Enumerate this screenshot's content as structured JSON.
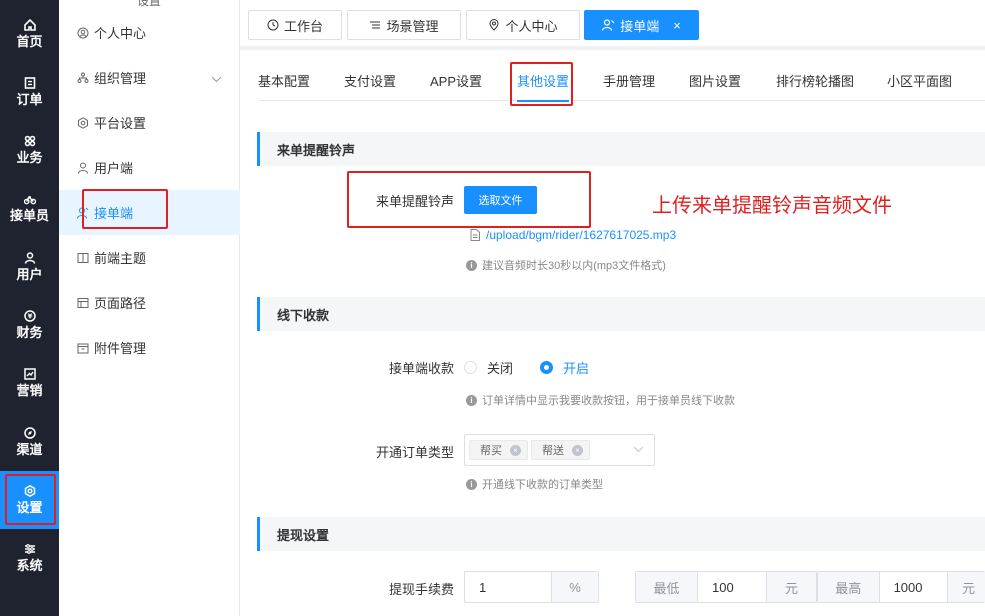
{
  "nav": {
    "items": [
      {
        "label": "首页",
        "icon": "home-icon"
      },
      {
        "label": "订单",
        "icon": "order-icon"
      },
      {
        "label": "业务",
        "icon": "business-icon"
      },
      {
        "label": "接单员",
        "icon": "rider-icon"
      },
      {
        "label": "用户",
        "icon": "user-icon"
      },
      {
        "label": "财务",
        "icon": "finance-icon"
      },
      {
        "label": "营销",
        "icon": "marketing-icon"
      },
      {
        "label": "渠道",
        "icon": "channel-icon"
      },
      {
        "label": "设置",
        "icon": "settings-icon"
      },
      {
        "label": "系统",
        "icon": "system-icon"
      }
    ],
    "active_index": 8,
    "accent": "#1890ff",
    "bg": "#1f2330"
  },
  "submenu": {
    "head": "设置",
    "items": [
      {
        "label": "个人中心",
        "icon": "user-circle-icon"
      },
      {
        "label": "组织管理",
        "icon": "org-icon"
      },
      {
        "label": "平台设置",
        "icon": "hexagon-settings-icon"
      },
      {
        "label": "用户端",
        "icon": "person-icon"
      },
      {
        "label": "接单端",
        "icon": "rider-person-icon"
      },
      {
        "label": "前端主题",
        "icon": "theme-icon"
      },
      {
        "label": "页面路径",
        "icon": "path-icon"
      },
      {
        "label": "附件管理",
        "icon": "attachment-icon"
      }
    ],
    "active_index": 4
  },
  "tags": [
    {
      "label": "工作台",
      "icon": "dashboard-icon"
    },
    {
      "label": "场景管理",
      "icon": "list-icon"
    },
    {
      "label": "个人中心",
      "icon": "location-user-icon"
    },
    {
      "label": "接单端",
      "icon": "rider-person-icon",
      "closable": "×"
    }
  ],
  "tabs": [
    "基本配置",
    "支付设置",
    "APP设置",
    "其他设置",
    "手册管理",
    "图片设置",
    "排行榜轮播图",
    "小区平面图"
  ],
  "active_tab": 3,
  "ringtone": {
    "section_title": "来单提醒铃声",
    "label": "来单提醒铃声",
    "button": "选取文件",
    "file": "/upload/bgm/rider/1627617025.mp3",
    "hint": "建议音频时长30秒以内(mp3文件格式)",
    "annotation": "上传来单提醒铃声音频文件"
  },
  "offline": {
    "section_title": "线下收款",
    "collect_label": "接单端收款",
    "option_off": "关闭",
    "option_on": "开启",
    "collect_hint": "订单详情中显示我要收款按钮，用于接单员线下收款",
    "types_label": "开通订单类型",
    "types": [
      "帮买",
      "帮送"
    ],
    "types_hint": "开通线下收款的订单类型"
  },
  "withdraw": {
    "section_title": "提现设置",
    "fee_label": "提现手续费",
    "fee_value": "1",
    "fee_unit": "%",
    "min_label": "最低",
    "min_value": "100",
    "min_unit": "元",
    "max_label": "最高",
    "max_value": "1000",
    "max_unit": "元"
  }
}
